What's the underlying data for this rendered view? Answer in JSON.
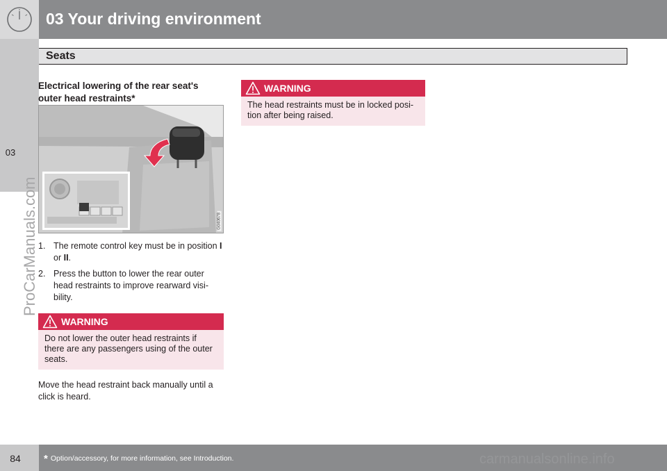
{
  "header": {
    "chapter_title": "03 Your driving environment",
    "section_title": "Seats",
    "chapter_tab": "03"
  },
  "left_column": {
    "heading": "Electrical lowering of the rear seat's outer head restraints*",
    "figure_code": "G040678",
    "steps": [
      {
        "number": "1.",
        "text_before": "The remote control key must be in position ",
        "bold_1": "I",
        "middle": " or ",
        "bold_2": "II",
        "text_after": "."
      },
      {
        "number": "2.",
        "text": "Press the button to lower the rear outer head restraints to improve rearward visi-bility."
      }
    ],
    "warning": {
      "label": "WARNING",
      "text": "Do not lower the outer head restraints if there are any passengers using of the outer seats."
    },
    "paragraph": "Move the head restraint back manually until a click is heard."
  },
  "right_column": {
    "warning": {
      "label": "WARNING",
      "text": "The head restraints must be in locked posi-tion after being raised."
    }
  },
  "footer": {
    "page_number": "84",
    "star": "*",
    "footnote": "Option/accessory, for more information, see Introduction."
  },
  "watermarks": {
    "side": "ProCarManuals.com",
    "bottom": "carmanualsonline.info"
  },
  "colors": {
    "header_gray": "#8a8b8d",
    "tab_gray": "#c8c8c9",
    "warning_red": "#d42b4f",
    "warning_pink": "#f8e5ea",
    "arrow_red": "#e0314f"
  },
  "icons": [
    "gauge-icon",
    "warning-triangle-icon",
    "down-arrow-icon"
  ]
}
